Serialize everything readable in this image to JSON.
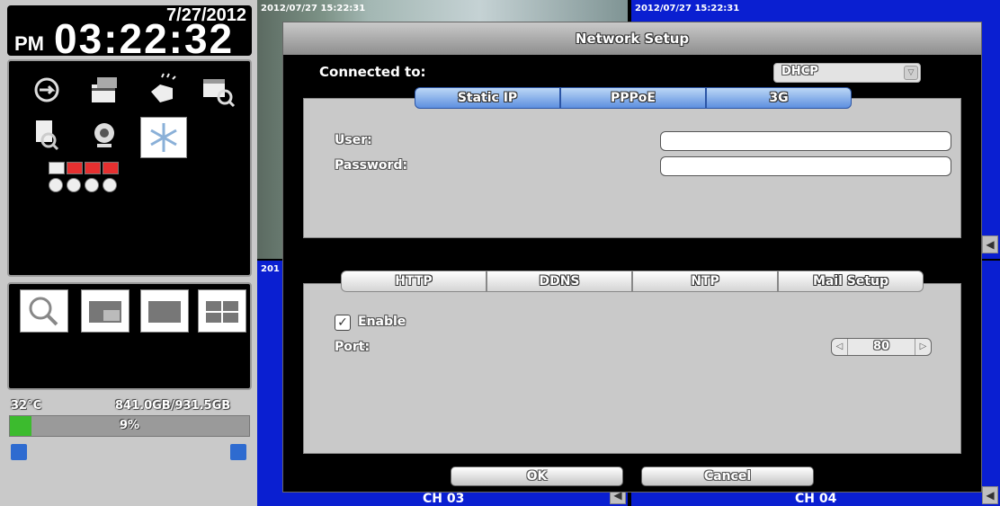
{
  "clock": {
    "date": "7/27/2012",
    "ampm": "PM",
    "time": "03:22:32"
  },
  "status": {
    "temperature": "32°C",
    "disk_usage": "841.0GB/931.5GB",
    "disk_percent_label": "9%",
    "disk_percent": 9
  },
  "colors": {
    "camera_bg": "#0a1fd1",
    "accent_blue": "#5d8fe0",
    "disk_fill": "#3cbb2e"
  },
  "left_panel": {
    "menu_icons": [
      "backup-icon",
      "file-icon",
      "hand-icon",
      "schedule-search-icon",
      "log-search-icon",
      "webcam-icon",
      "freeze-icon"
    ],
    "channel_status_icons": [
      "monitor-icon",
      "alarm-icon",
      "alarm-icon",
      "alarm-icon",
      "sensor-icon",
      "sensor-icon",
      "sensor-icon",
      "sensor-icon"
    ],
    "view_icons": [
      "zoom-icon",
      "pip-layout-icon",
      "single-layout-icon",
      "quad-layout-icon"
    ],
    "bottom_icons": [
      "network-icon",
      "user-icon"
    ]
  },
  "cameras": [
    {
      "timestamp": "2012/07/27 15:22:31",
      "channel": ""
    },
    {
      "timestamp": "2012/07/27 15:22:31",
      "channel": ""
    },
    {
      "timestamp": "201",
      "channel": "CH 03"
    },
    {
      "timestamp": "",
      "channel": "CH 04"
    }
  ],
  "dialog": {
    "title": "Network Setup",
    "connected_label": "Connected to:",
    "connection_mode": "DHCP",
    "tabs_top": [
      "Static IP",
      "PPPoE",
      "3G"
    ],
    "user_label": "User:",
    "password_label": "Password:",
    "user_value": "",
    "password_value": "",
    "tabs_bottom": [
      "HTTP",
      "DDNS",
      "NTP",
      "Mail Setup"
    ],
    "enable_label": "Enable",
    "enable_checked": true,
    "port_label": "Port:",
    "port_value": "80",
    "ok_label": "OK",
    "cancel_label": "Cancel"
  }
}
